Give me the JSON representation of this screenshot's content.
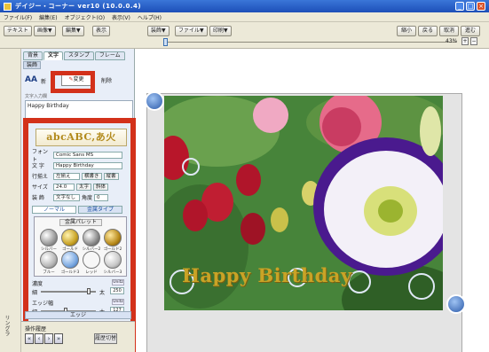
{
  "window": {
    "title": "デイジー・コーナー ver10 (10.0.0.4)"
  },
  "menu": [
    "ファイル(F)",
    "編集(E)",
    "オブジェクト(O)",
    "表示(V)",
    "ヘルプ(H)"
  ],
  "toolbar": {
    "buttons": [
      "テキスト",
      "画像▼",
      "編集▼",
      "表示",
      "装飾▼",
      "ファイル▼",
      "印刷▼"
    ],
    "right_buttons": [
      "縮小",
      "戻る",
      "取消",
      "進む"
    ],
    "zoom": "43%"
  },
  "panel": {
    "tabs": [
      "背景",
      "文字",
      "スタンプ",
      "フレーム"
    ],
    "subtab": "装飾",
    "aa_label": "AA",
    "aa_text": "新",
    "change_label": "変更",
    "delete_label": "削除",
    "note": "文字入力欄",
    "text_value": "Happy Birthday",
    "preview": "abcABC,あ火",
    "font_label": "フォント",
    "font_value": "Comic Sans MS",
    "text_label": "文 字",
    "text_field": "Happy Birthday",
    "style_label": "行揃え",
    "style_value": "左揃え",
    "vertical": "横書き",
    "horizontal": "縦書",
    "size_label": "サイズ",
    "size_value": "24.0",
    "bold": "太字",
    "italic": "斜体",
    "deco_label": "装 飾",
    "deco_value": "文字なし",
    "angle_label": "角度",
    "angle_value": "0",
    "grad_tabs": [
      "ノーマル",
      "金属タイプ"
    ],
    "palette_title": "金属パレット",
    "swatches": [
      "シルバー",
      "ゴールド",
      "シルバー2",
      "ゴールド2",
      "ブルー",
      "ゴールド3",
      "レッド",
      "シルバー3"
    ],
    "thickness_label": "濃度",
    "thickness_left": "細",
    "thickness_right": "太",
    "thickness_value": "250",
    "edge_label": "エッジ幅",
    "edge_left": "細",
    "edge_right": "太",
    "edge_value": "127",
    "unit": "Unitz",
    "edge_bar": "エッジ",
    "history_title": "操作履歴",
    "nav": [
      "«",
      "‹",
      "›",
      "»"
    ],
    "recall": "履歴切替",
    "side_text": "リングラ"
  },
  "canvas": {
    "greeting": "Happy Birthday",
    "accent": "#d3311a"
  }
}
